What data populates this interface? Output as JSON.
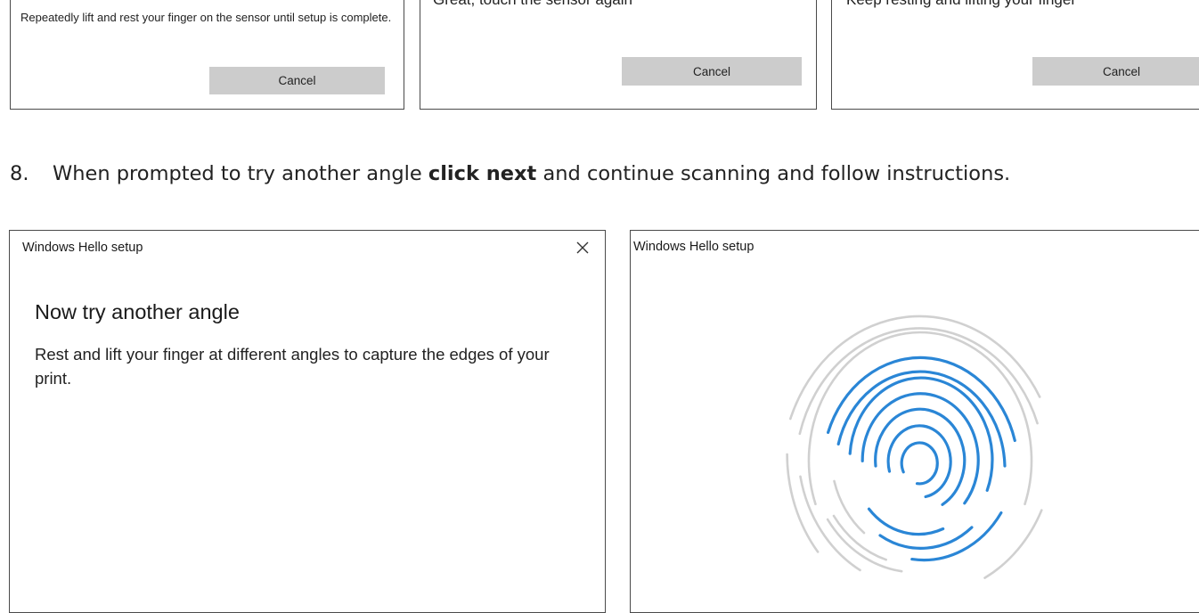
{
  "panels_top": [
    {
      "body": "Repeatedly lift and rest your finger on the sensor until setup is complete.",
      "cancel_label": "Cancel"
    },
    {
      "partial_text": "Great, touch the sensor again",
      "cancel_label": "Cancel"
    },
    {
      "partial_text": "Keep resting and lifting your finger",
      "cancel_label": "Cancel"
    }
  ],
  "step": {
    "number": "8.",
    "text_before": "When prompted to try another angle ",
    "text_bold": "click next",
    "text_after": " and continue scanning and follow instructions."
  },
  "dialog_angle": {
    "window_title": "Windows Hello setup",
    "heading": "Now try another angle",
    "body": "Rest and lift your finger at different angles to capture the edges of your print.",
    "close_icon": "close-icon"
  },
  "dialog_fingerprint": {
    "window_title": "Windows Hello setup",
    "illustration_icon": "fingerprint-icon",
    "colors": {
      "captured": "#2a86d6",
      "pending": "#d0d0d0"
    }
  }
}
